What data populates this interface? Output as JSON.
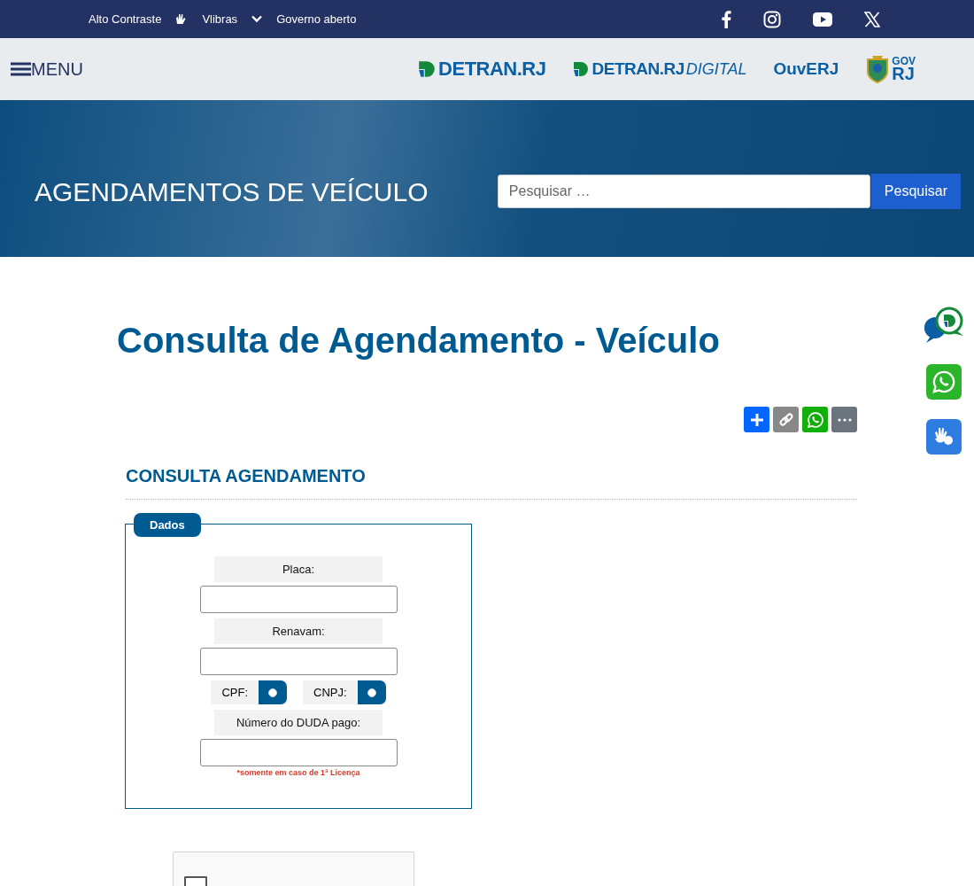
{
  "top_bar": {
    "links": [
      {
        "kind": "text",
        "label": "Alto Contraste"
      },
      {
        "kind": "hands",
        "label": "Vlibras"
      },
      {
        "kind": "chevron",
        "label": "Governo aberto"
      }
    ],
    "social": [
      {
        "kind": "facebook"
      },
      {
        "kind": "instagram"
      },
      {
        "kind": "youtube"
      },
      {
        "kind": "x"
      }
    ]
  },
  "header": {
    "menu_label": "MENU",
    "logos": [
      {
        "kind": "detran",
        "text": "DETRAN.RJ"
      },
      {
        "kind": "detran_digital",
        "text": "DETRAN.RJ",
        "suffix": "DIGITAL"
      },
      {
        "kind": "ouvidoria",
        "text": "OuvERJ"
      },
      {
        "kind": "gov",
        "top": "GOV",
        "bottom": "RJ"
      }
    ]
  },
  "hero": {
    "title": "AGENDAMENTOS DE VEÍCULO",
    "search": {
      "placeholder": "Pesquisar …",
      "button": "Pesquisar"
    }
  },
  "page_title": "Consulta de Agendamento - Veículo",
  "share": [
    {
      "kind": "add"
    },
    {
      "kind": "link"
    },
    {
      "kind": "whatsapp"
    },
    {
      "kind": "more"
    }
  ],
  "floating": [
    {
      "kind": "chat"
    },
    {
      "kind": "whatsapp"
    },
    {
      "kind": "libras"
    }
  ],
  "section_title": "CONSULTA AGENDAMENTO",
  "form": {
    "legend": "Dados",
    "fields": [
      {
        "kind": "text",
        "label": "Placa:"
      },
      {
        "kind": "text",
        "label": "Renavam:"
      },
      {
        "kind": "radios",
        "options": [
          {
            "label": "CPF:",
            "selected": false
          },
          {
            "label": "CNPJ:",
            "selected": false
          }
        ]
      },
      {
        "kind": "text",
        "label": "Número do DUDA pago:",
        "note": "*somente em caso de 1ª Licença"
      }
    ]
  },
  "captcha": {
    "checked": false
  }
}
